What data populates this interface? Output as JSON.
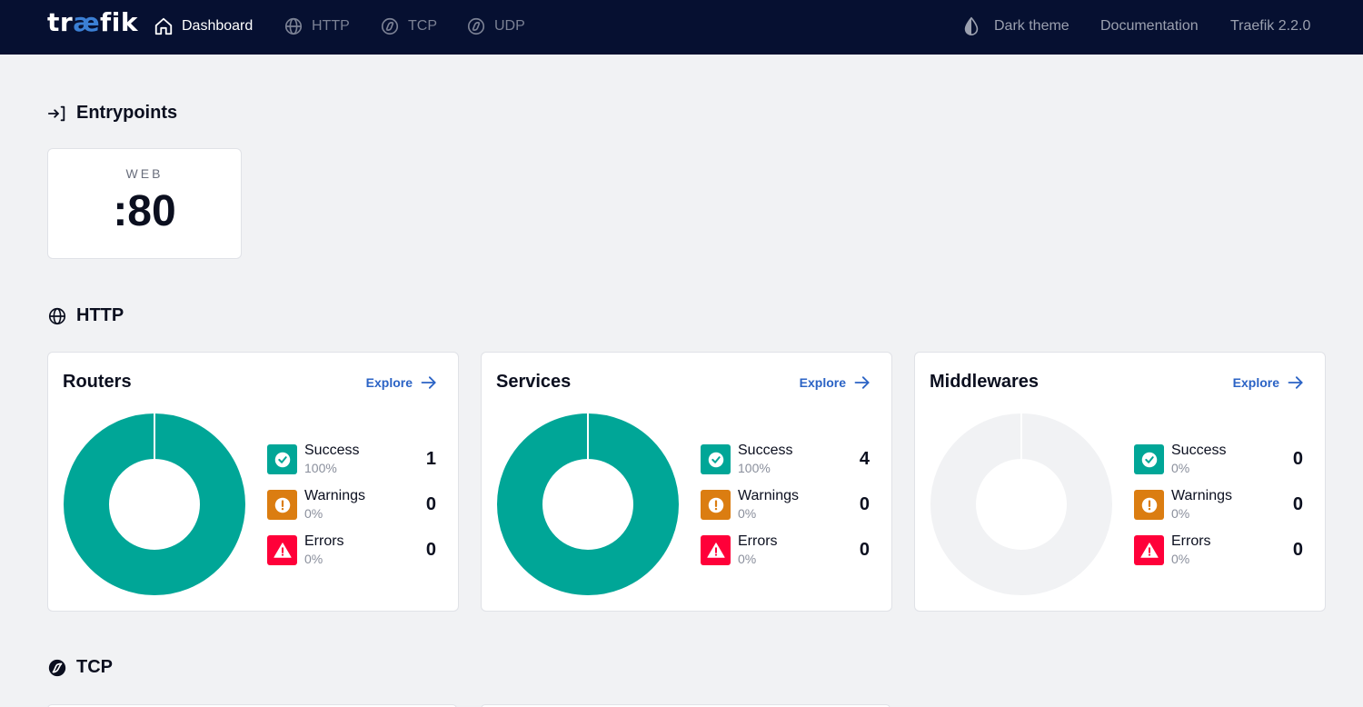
{
  "nav": {
    "logo_prefix": "tr",
    "logo_accent": "æ",
    "logo_suffix": "fik",
    "items": [
      {
        "label": "Dashboard",
        "icon": "home-icon",
        "active": true
      },
      {
        "label": "HTTP",
        "icon": "globe-icon",
        "active": false
      },
      {
        "label": "TCP",
        "icon": "tcp-icon",
        "active": false
      },
      {
        "label": "UDP",
        "icon": "udp-icon",
        "active": false
      }
    ],
    "theme_label": "Dark theme",
    "theme_icon": "droplet-half-icon",
    "docs_label": "Documentation",
    "version_label": "Traefik 2.2.0"
  },
  "entrypoints": {
    "title": "Entrypoints",
    "icon": "login-arrow-icon",
    "items": [
      {
        "name": "WEB",
        "port": ":80"
      }
    ]
  },
  "http": {
    "title": "HTTP",
    "icon": "globe-icon",
    "explore_label": "Explore",
    "cards": [
      {
        "title": "Routers",
        "stats": [
          {
            "label": "Success",
            "pct": "100%",
            "count": "1"
          },
          {
            "label": "Warnings",
            "pct": "0%",
            "count": "0"
          },
          {
            "label": "Errors",
            "pct": "0%",
            "count": "0"
          }
        ]
      },
      {
        "title": "Services",
        "stats": [
          {
            "label": "Success",
            "pct": "100%",
            "count": "4"
          },
          {
            "label": "Warnings",
            "pct": "0%",
            "count": "0"
          },
          {
            "label": "Errors",
            "pct": "0%",
            "count": "0"
          }
        ]
      },
      {
        "title": "Middlewares",
        "stats": [
          {
            "label": "Success",
            "pct": "0%",
            "count": "0"
          },
          {
            "label": "Warnings",
            "pct": "0%",
            "count": "0"
          },
          {
            "label": "Errors",
            "pct": "0%",
            "count": "0"
          }
        ]
      }
    ]
  },
  "tcp": {
    "title": "TCP",
    "icon": "tcp-icon"
  },
  "colors": {
    "nav_bg": "#061031",
    "success": "#00a697",
    "warning": "#db7d11",
    "error": "#ff0039",
    "empty_ring": "#f1f2f4",
    "link": "#2b63c5"
  }
}
